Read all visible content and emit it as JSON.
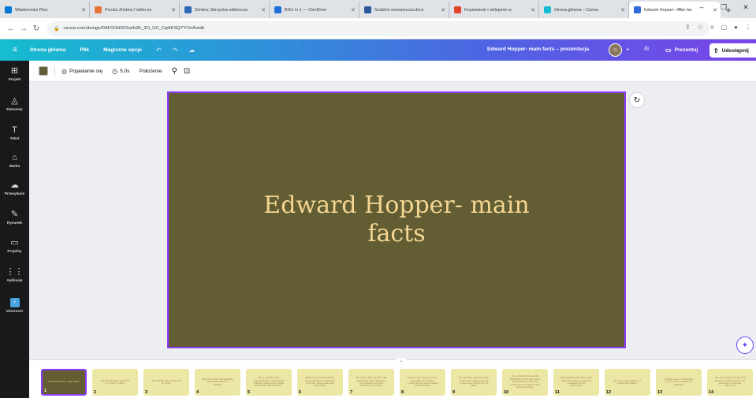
{
  "browser": {
    "tabs": [
      {
        "label": "Wiadomości Plus",
        "fav": "#0078d4"
      },
      {
        "label": "Poczta Zimbra / lublin.eu",
        "fav": "#e8743b"
      },
      {
        "label": "Zimbra: Skrzynka odbiorcza",
        "fav": "#2f6ab8"
      },
      {
        "label": "BSU nr 1 — OneDrive",
        "fav": "#1e6ed6"
      },
      {
        "label": "Szablon scenariusza.docx",
        "fav": "#2b579a"
      },
      {
        "label": "Kopiowanie i wklejanie w",
        "fav": "#e1442b"
      },
      {
        "label": "Strona główna – Canva",
        "fav": "#16bdcf"
      },
      {
        "label": "Edward Hopper- main fac",
        "fav": "#2f6ad6"
      }
    ],
    "new_tab": "+",
    "window_controls": [
      "⌄",
      "–",
      "❐",
      "✕"
    ],
    "url": "canva.com/design/DAF0Okf92Xw/b3K_3O_UC_CqNKSQYYOoA/edit"
  },
  "canva_bar": {
    "home": "Strona główna",
    "file": "Plik",
    "magic": "Magiczne opcje",
    "doc_title": "Edward Hopper- main facts – prezentacja",
    "present": "Prezentuj",
    "share": "Udostępnij"
  },
  "sidebar": [
    {
      "label": "Projekt",
      "icon": "layout-icon",
      "glyph": "⊞"
    },
    {
      "label": "Elementy",
      "icon": "elements-icon",
      "glyph": "◬"
    },
    {
      "label": "Tekst",
      "icon": "text-icon",
      "glyph": "T"
    },
    {
      "label": "Marka",
      "icon": "brand-icon",
      "glyph": "⌂"
    },
    {
      "label": "Przesyłanie",
      "icon": "upload-icon",
      "glyph": "☁"
    },
    {
      "label": "Rysunek",
      "icon": "draw-icon",
      "glyph": "✎"
    },
    {
      "label": "Projekty",
      "icon": "folder-icon",
      "glyph": "▭"
    },
    {
      "label": "Aplikacje",
      "icon": "apps-icon",
      "glyph": "⋮⋮"
    },
    {
      "label": "Voiceover",
      "icon": "voiceover-icon",
      "glyph": "♪"
    }
  ],
  "toolbar": {
    "color": "#635d33",
    "animate": "Pojawianie się",
    "duration": "5.0s",
    "position": "Położenie"
  },
  "slide": {
    "title": "Edward Hopper- main facts",
    "background": "#635d33",
    "text_color": "#f4d693"
  },
  "thumbnails": [
    {
      "num": "1",
      "text": "Edward Hopper- main facts"
    },
    {
      "num": "2",
      "text": "Edward Hopper was born in Nyack in 1882."
    },
    {
      "num": "3",
      "text": "He lived in New York City in 1910."
    },
    {
      "num": "4",
      "text": "He is the most recognizable American painter of realism."
    },
    {
      "num": "5",
      "text": "He is considered a representative of American realism, although he called himself an impressionist."
    },
    {
      "num": "6",
      "text": "Before he became famous he worked as an illustrator in books, trade press and magazines."
    },
    {
      "num": "7",
      "text": "The artist didn't work in his studio like other painters, he traveled a lot and painted from nature."
    },
    {
      "num": "8",
      "text": "Hopper was always a very shy man, he avoided crowds and he never talked about himself."
    },
    {
      "num": "9",
      "text": "He carefully planned each work, first making dozens of sketches, before the oil paint."
    },
    {
      "num": "10",
      "text": "He won first prize at the Exhibition of the Art of the Independence Hall, his works were created in the American style."
    },
    {
      "num": "11",
      "text": "His paintings are filled with light and shadows, and the loneliness of the characters."
    },
    {
      "num": "12",
      "text": "He was a big admirer of Degas and Manet."
    },
    {
      "num": "13",
      "text": "Hopper was so rewarded, he got a lot of awards in painting."
    },
    {
      "num": "14",
      "text": "The artist was very shy and used the background of his paintings to express emotions."
    }
  ]
}
